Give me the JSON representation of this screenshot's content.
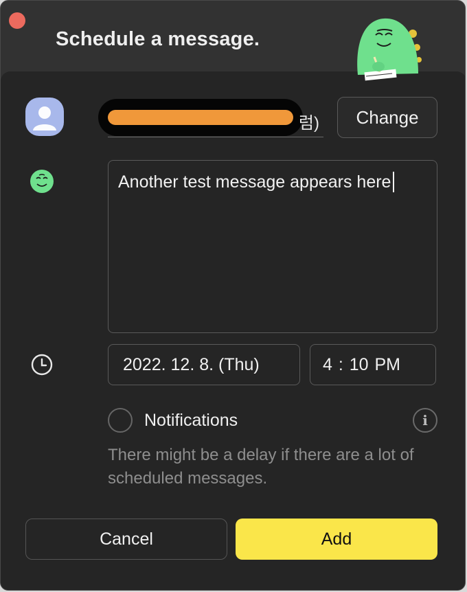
{
  "window": {
    "title": "Schedule a message."
  },
  "recipient": {
    "name_suffix": "럼)",
    "change_label": "Change"
  },
  "message": {
    "text": "Another test message appears here"
  },
  "schedule": {
    "date": "2022. 12. 8. (Thu)",
    "time": "4 : 10 PM"
  },
  "notifications": {
    "label": "Notifications",
    "info_symbol": "i",
    "hint": "There might be a delay if there are a lot of scheduled messages."
  },
  "actions": {
    "cancel_label": "Cancel",
    "add_label": "Add"
  },
  "icons": {
    "close": "close-dot-icon",
    "mascot": "mascot-writing-icon",
    "avatar": "user-avatar-icon",
    "emoticon": "emoticon-face-icon",
    "clock": "clock-icon",
    "info": "info-icon"
  },
  "colors": {
    "accent_add": "#fae64a",
    "close_dot": "#ec6a5e",
    "avatar_bg": "#a8b8eb",
    "mascot_green": "#6fe08d",
    "redaction_orange": "#f0983a"
  }
}
